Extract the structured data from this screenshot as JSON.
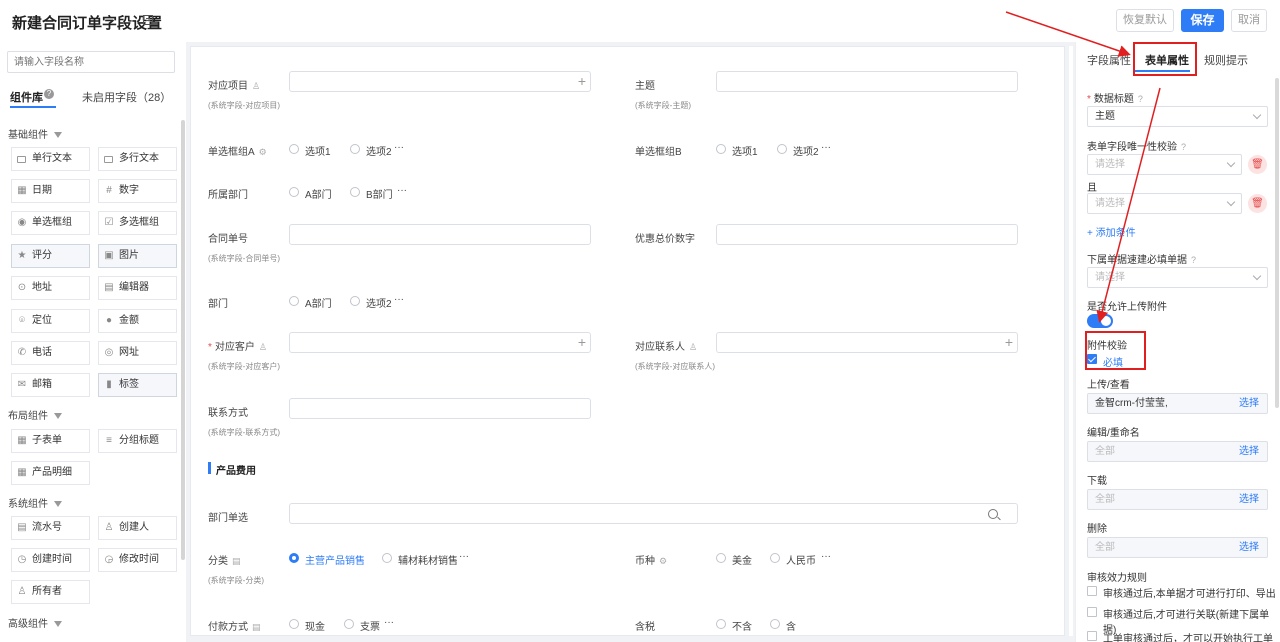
{
  "header": {
    "title": "新建合同订单字段设置",
    "buttons": {
      "reset": "恢复默认",
      "save": "保存",
      "cancel": "取消"
    }
  },
  "left": {
    "search_placeholder": "请输入字段名称",
    "tabs": {
      "library": "组件库",
      "disabled": "未启用字段（28）"
    },
    "sections": {
      "basic": "基础组件",
      "layout": "布局组件",
      "system": "系统组件",
      "advanced": "高级组件"
    },
    "basic_items": [
      "单行文本",
      "多行文本",
      "日期",
      "数字",
      "单选框组",
      "多选框组",
      "评分",
      "图片",
      "地址",
      "编辑器",
      "定位",
      "金额",
      "电话",
      "网址",
      "邮箱",
      "标签"
    ],
    "layout_items": [
      "子表单",
      "分组标题",
      "产品明细"
    ],
    "system_items": [
      "流水号",
      "创建人",
      "创建时间",
      "修改时间",
      "所有者"
    ]
  },
  "form": {
    "f1": {
      "label": "对应项目",
      "sub": "(系统字段-对应项目)"
    },
    "f2": {
      "label": "主题",
      "sub": "(系统字段-主题)"
    },
    "f3": {
      "label": "单选框组A",
      "o1": "选项1",
      "o2": "选项2"
    },
    "f4": {
      "label": "单选框组B",
      "o1": "选项1",
      "o2": "选项2"
    },
    "f5": {
      "label": "所属部门",
      "o1": "A部门",
      "o2": "B部门"
    },
    "f6": {
      "label": "合同单号",
      "sub": "(系统字段-合同单号)"
    },
    "f7": {
      "label": "优惠总价数字"
    },
    "f8": {
      "label": "部门",
      "o1": "A部门",
      "o2": "选项2"
    },
    "f9": {
      "label": "对应客户",
      "sub": "(系统字段-对应客户)"
    },
    "f10": {
      "label": "对应联系人",
      "sub": "(系统字段-对应联系人)"
    },
    "f11": {
      "label": "联系方式",
      "sub": "(系统字段-联系方式)"
    },
    "section": "产品费用",
    "f12": {
      "label": "部门单选"
    },
    "f13": {
      "label": "分类",
      "sub": "(系统字段-分类)",
      "o1": "主营产品销售",
      "o2": "辅材耗材销售"
    },
    "f14": {
      "label": "币种",
      "o1": "美金",
      "o2": "人民币"
    },
    "f15": {
      "label": "付款方式",
      "o1": "现金",
      "o2": "支票"
    },
    "f16": {
      "label": "含税",
      "o1": "不含",
      "o2": "含"
    },
    "more": "···",
    "asterisk": "*"
  },
  "right": {
    "tabs": {
      "field": "字段属性",
      "form": "表单属性",
      "rules": "规则提示"
    },
    "data_title_label": "数据标题",
    "data_title_value": "主题",
    "unique_label": "表单字段唯一性校验",
    "select_placeholder": "请选择",
    "and_label": "且",
    "add_condition": "+ 添加条件",
    "sub_required_label": "下属单据速建必填单据",
    "allow_upload_label": "是否允许上传附件",
    "attach_check_label": "附件校验",
    "required_label": "必填",
    "upload_view_label": "上传/查看",
    "upload_view_value": "金智crm-付莹莹,",
    "choose": "选择",
    "edit_label": "编辑/重命名",
    "all": "全部",
    "download_label": "下载",
    "delete_label": "删除",
    "audit_label": "审核效力规则",
    "audit1": "审核通过后,本单据才可进行打印、导出",
    "audit2": "审核通过后,才可进行关联(新建下属单据)",
    "audit3": "工单审核通过后，才可以开始执行工单进"
  },
  "colors": {
    "accent": "#2e7cf6",
    "annotation": "#e02020"
  }
}
